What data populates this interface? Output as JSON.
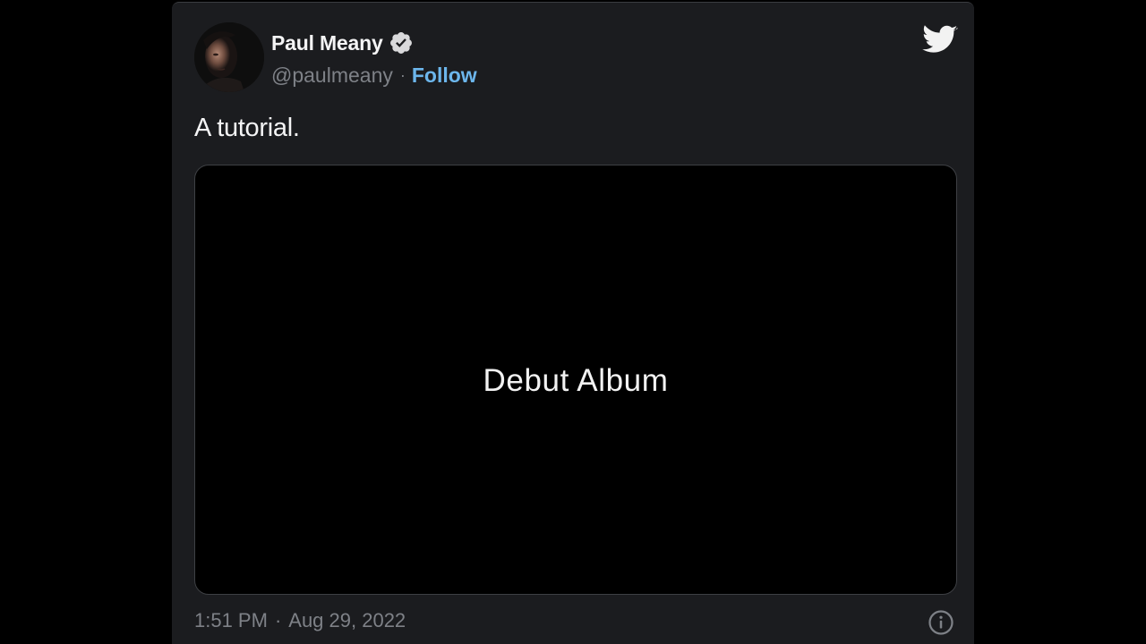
{
  "tweet": {
    "author_name": "Paul Meany",
    "handle": "@paulmeany",
    "separator": "·",
    "follow_label": "Follow",
    "text": "A tutorial.",
    "media_title": "Debut Album",
    "time": "1:51 PM",
    "date": "Aug 29, 2022",
    "icons": {
      "verified": "verified-badge-icon",
      "brand": "twitter-bird-icon",
      "info": "info-icon"
    }
  },
  "colors": {
    "card_background": "#1b1c1f",
    "page_background": "#000000",
    "follow_link": "#6cb6ec",
    "muted_text": "#7e8187",
    "primary_text": "#f4f4f5"
  }
}
